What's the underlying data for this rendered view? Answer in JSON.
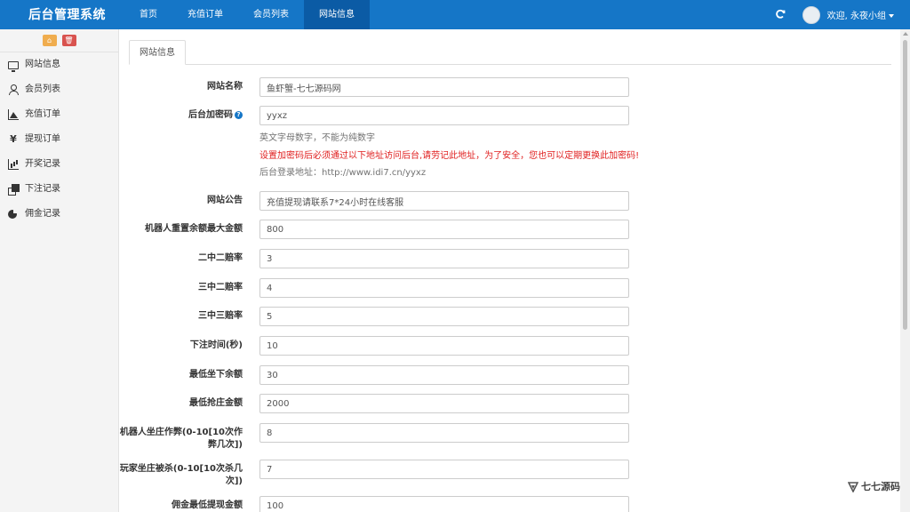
{
  "navbar": {
    "brand": "后台管理系统",
    "items": [
      {
        "label": "首页",
        "active": false
      },
      {
        "label": "充值订单",
        "active": false
      },
      {
        "label": "会员列表",
        "active": false
      },
      {
        "label": "网站信息",
        "active": true
      }
    ],
    "user_label": "欢迎, 永夜小组"
  },
  "sidebar": {
    "items": [
      {
        "label": "网站信息",
        "icon": "monitor-icon"
      },
      {
        "label": "会员列表",
        "icon": "user-icon"
      },
      {
        "label": "充值订单",
        "icon": "area-chart-icon"
      },
      {
        "label": "提现订单",
        "icon": "yen-icon"
      },
      {
        "label": "开奖记录",
        "icon": "bar-chart-icon"
      },
      {
        "label": "下注记录",
        "icon": "clone-icon"
      },
      {
        "label": "佣金记录",
        "icon": "pie-chart-icon"
      }
    ]
  },
  "tab": {
    "label": "网站信息"
  },
  "form": {
    "site_name": {
      "label": "网站名称",
      "value": "鱼虾蟹-七七源码网"
    },
    "admin_code": {
      "label": "后台加密码",
      "value": "yyxz",
      "hint1": "英文字母数字，不能为纯数字",
      "hint2": "设置加密码后必须通过以下地址访问后台,请劳记此地址，为了安全，您也可以定期更换此加密码!",
      "hint3": "后台登录地址：http://www.idi7.cn/yyxz"
    },
    "notice": {
      "label": "网站公告",
      "value": "充值提现请联系7*24小时在线客服"
    },
    "robot_max": {
      "label": "机器人重置余额最大金额",
      "value": "800"
    },
    "rate_22": {
      "label": "二中二赔率",
      "value": "3"
    },
    "rate_32": {
      "label": "三中二赔率",
      "value": "4"
    },
    "rate_33": {
      "label": "三中三赔率",
      "value": "5"
    },
    "bet_time": {
      "label": "下注时间(秒)",
      "value": "10"
    },
    "min_sit": {
      "label": "最低坐下余额",
      "value": "30"
    },
    "min_banker": {
      "label": "最低抢庄金额",
      "value": "2000"
    },
    "robot_cheat": {
      "label_line1": "机器人坐庄作弊(0-10[10次作",
      "label_line2": "弊几次])",
      "value": "8"
    },
    "player_kill": {
      "label_line1": "玩家坐庄被杀(0-10[10次杀几",
      "label_line2": "次])",
      "value": "7"
    },
    "min_commission": {
      "label": "佣金最低提现金额",
      "value": "100"
    }
  },
  "watermark": {
    "text": "七七源码"
  },
  "colors": {
    "navbar": "#1576c7",
    "navbar_active": "#0b5ba5",
    "hint_red": "#e02020",
    "home_btn": "#f0ad4e",
    "del_btn": "#d9534f"
  }
}
